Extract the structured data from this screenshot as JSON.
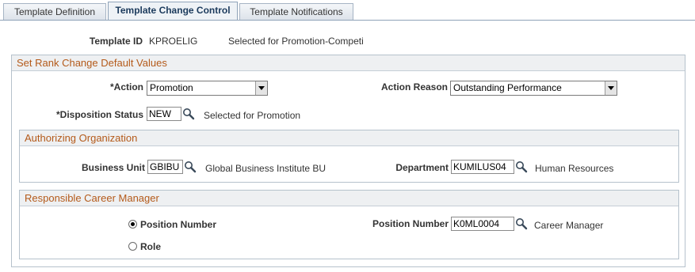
{
  "tabs": [
    {
      "label": "Template Definition",
      "active": false
    },
    {
      "label": "Template Change Control",
      "active": true
    },
    {
      "label": "Template Notifications",
      "active": false
    }
  ],
  "header": {
    "template_id_label": "Template ID",
    "template_id": "KPROELIG",
    "template_desc": "Selected for Promotion-Competi"
  },
  "rank_change": {
    "title": "Set Rank Change Default Values",
    "action_label": "*Action",
    "action_value": "Promotion",
    "action_reason_label": "Action Reason",
    "action_reason_value": "Outstanding Performance",
    "disposition_label": "*Disposition Status",
    "disposition_value": "NEW",
    "disposition_desc": "Selected for Promotion"
  },
  "authorizing_org": {
    "title": "Authorizing Organization",
    "business_unit_label": "Business Unit",
    "business_unit_value": "GBIBU",
    "business_unit_desc": "Global Business Institute BU",
    "department_label": "Department",
    "department_value": "KUMILUS04",
    "department_desc": "Human Resources"
  },
  "career_manager": {
    "title": "Responsible Career Manager",
    "radio_position_label": "Position Number",
    "radio_role_label": "Role",
    "selected": "Position Number",
    "position_number_label": "Position Number",
    "position_number_value": "K0ML0004",
    "position_number_desc": "Career Manager"
  },
  "icons": {
    "lookup": "magnifier-icon",
    "dropdown": "chevron-down-icon"
  }
}
